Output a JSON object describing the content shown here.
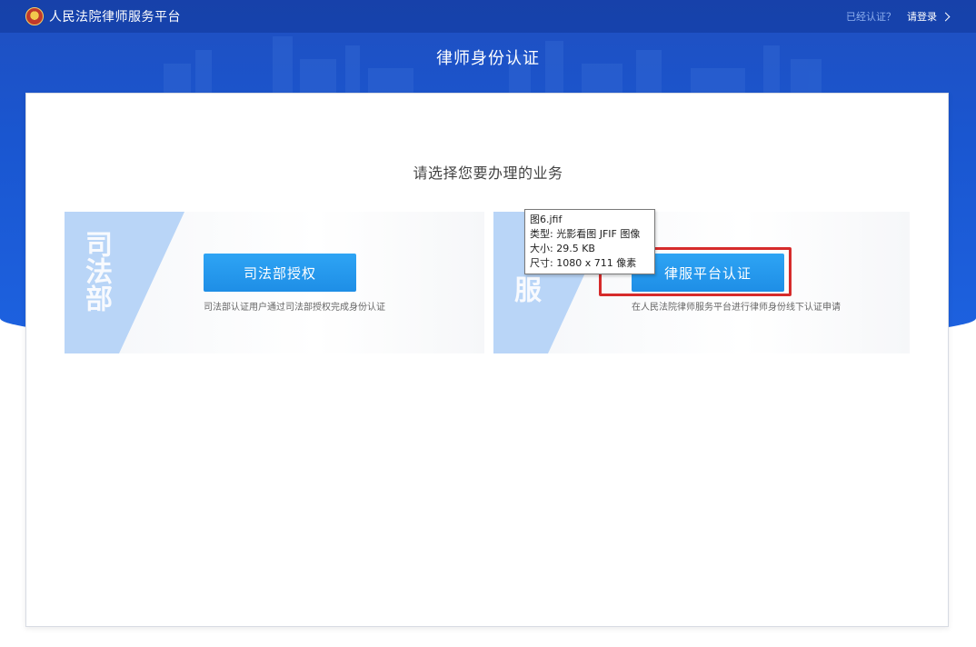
{
  "app": {
    "brand_title": "人民法院律师服务平台",
    "verified_question": "已经认证？",
    "login_label": "请登录"
  },
  "page": {
    "title": "律师身份认证",
    "prompt": "请选择您要办理的业务"
  },
  "options": [
    {
      "badge_text": "司法部",
      "button_label": "司法部授权",
      "description": "司法部认证用户通过司法部授权完成身份认证"
    },
    {
      "badge_text": "服",
      "button_label": "律服平台认证",
      "description": "在人民法院律师服务平台进行律师身份线下认证申请"
    }
  ],
  "tooltip": {
    "line1": "图6.jfif",
    "line2": "类型: 光影看图 JFIF 图像",
    "line3": "大小: 29.5 KB",
    "line4": "尺寸: 1080 x 711 像素"
  },
  "colors": {
    "hero_blue": "#1a56d0",
    "button_blue": "#2196f3",
    "badge_blue": "#b9d5f7",
    "highlight_red": "#d62b2b"
  }
}
